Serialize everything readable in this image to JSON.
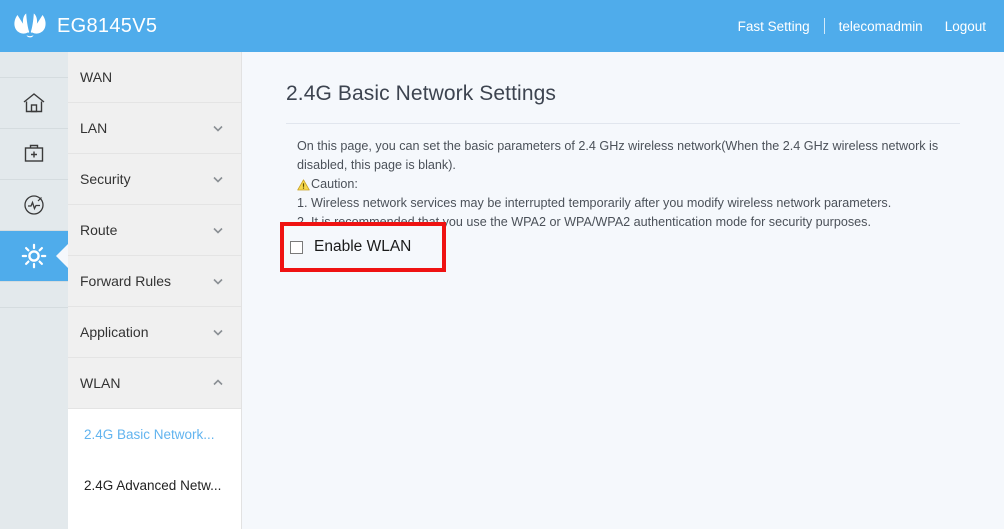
{
  "header": {
    "brand_name": "EG8145V5",
    "logo_icon": "huawei-flower-logo",
    "fast_setting": "Fast Setting",
    "username": "telecomadmin",
    "logout": "Logout"
  },
  "rail": {
    "items": [
      {
        "icon": "home-icon",
        "name": "home",
        "active": false
      },
      {
        "icon": "medical-kit-icon",
        "name": "diagnosis",
        "active": false
      },
      {
        "icon": "gauge-icon",
        "name": "monitoring",
        "active": false
      },
      {
        "icon": "gear-icon",
        "name": "settings",
        "active": true
      }
    ]
  },
  "menu": {
    "items": [
      {
        "label": "WAN",
        "chevron": "none"
      },
      {
        "label": "LAN",
        "chevron": "down"
      },
      {
        "label": "Security",
        "chevron": "down"
      },
      {
        "label": "Route",
        "chevron": "down"
      },
      {
        "label": "Forward Rules",
        "chevron": "down"
      },
      {
        "label": "Application",
        "chevron": "down"
      },
      {
        "label": "WLAN",
        "chevron": "up"
      }
    ],
    "submenu": [
      {
        "label": "2.4G Basic Network...",
        "active": true
      },
      {
        "label": "2.4G Advanced Netw...",
        "active": false
      }
    ]
  },
  "content": {
    "title": "2.4G Basic Network Settings",
    "description_line1": "On this page, you can set the basic parameters of 2.4 GHz wireless network(When the 2.4 GHz wireless network is disabled, this page is blank).",
    "caution_label": "Caution:",
    "caution_icon": "warning-triangle-icon",
    "caution_items": [
      "1. Wireless network services may be interrupted temporarily after you modify wireless network parameters.",
      "2. It is recommended that you use the WPA2 or WPA/WPA2 authentication mode for security purposes."
    ],
    "enable_wlan_label": "Enable WLAN",
    "enable_wlan_checked": false
  },
  "colors": {
    "header_blue": "#4faceb",
    "rail_bg": "#e3e9ec",
    "menu_bg": "#f0f0f0",
    "content_bg": "#f5f8fc",
    "active_link": "#62b4ef",
    "highlight_red": "#ef1212",
    "caution_yellow": "#f2c200"
  }
}
